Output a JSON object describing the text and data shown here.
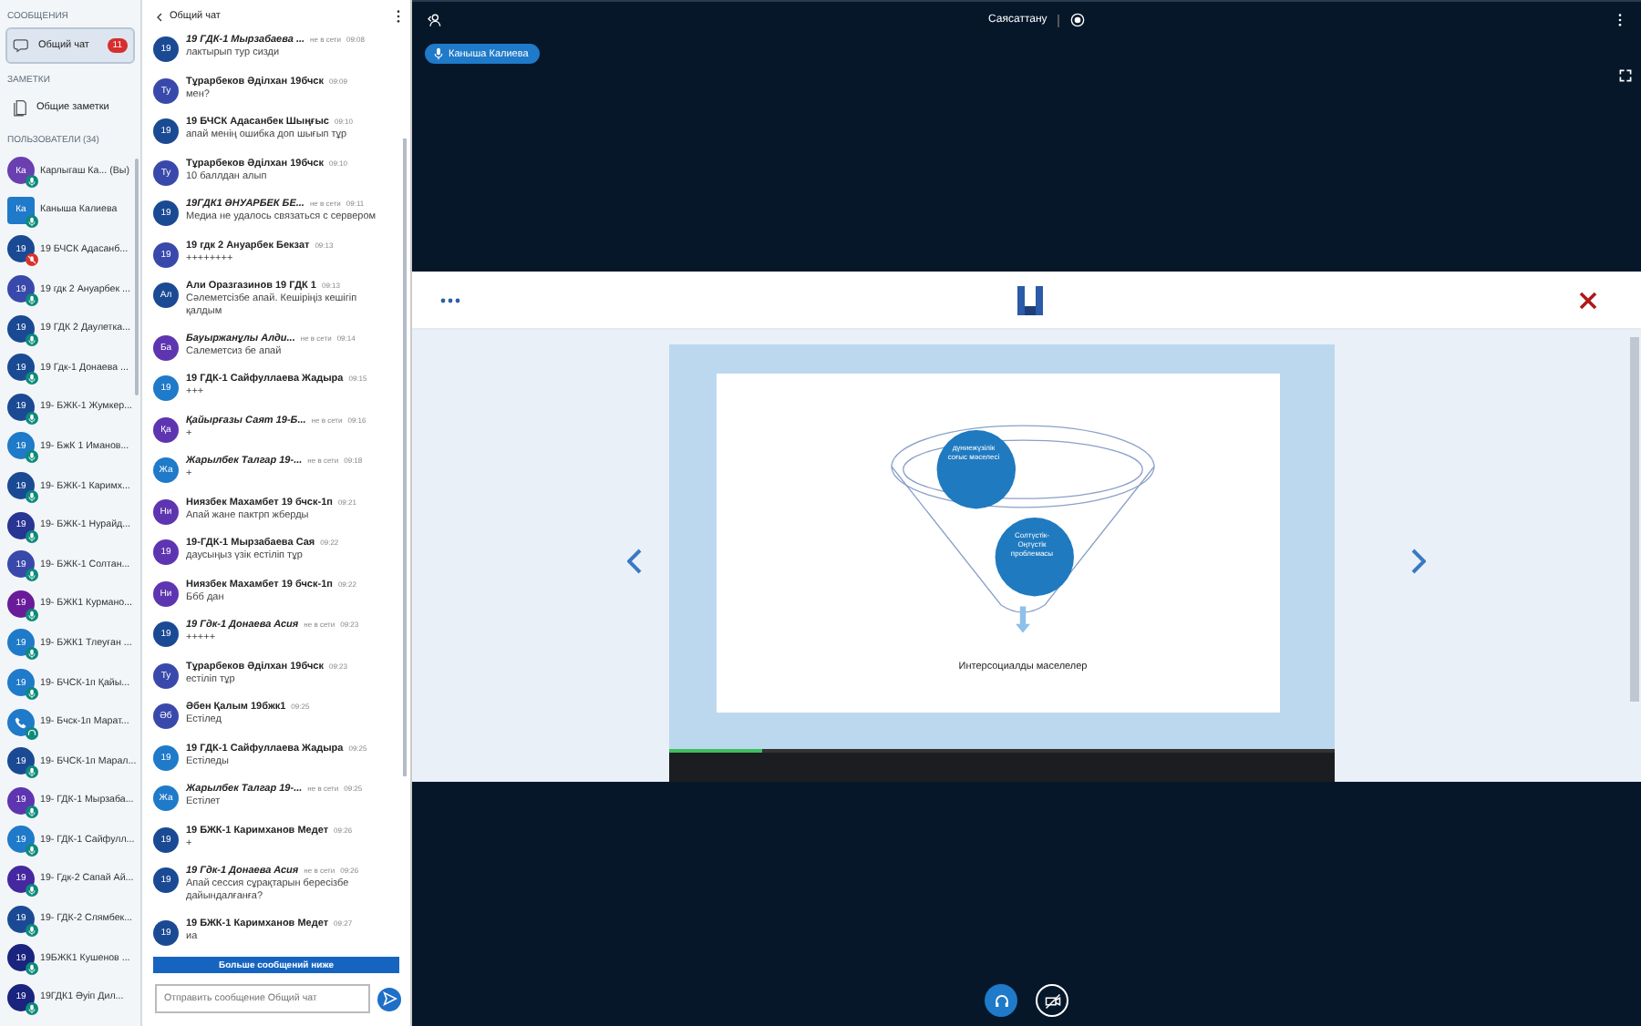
{
  "sidebar": {
    "messages_heading": "СООБЩЕНИЯ",
    "chats": [
      {
        "label": "Общий чат",
        "badge": "11",
        "selected": true
      }
    ],
    "notes_heading": "ЗАМЕТКИ",
    "notes": [
      {
        "label": "Общие заметки",
        "selected": false
      }
    ],
    "users_heading": "ПОЛЬЗОВАТЕЛИ (34)",
    "users": [
      {
        "initials": "Ка",
        "name": "Карлыгаш Ка... (Вы)",
        "color": "#6a3fb0",
        "presenter": false,
        "kind": "mic"
      },
      {
        "initials": "Ка",
        "name": "Каныша Калиева",
        "color": "#1f7ac9",
        "presenter": true,
        "kind": "mic"
      },
      {
        "initials": "19",
        "name": "19 БЧСК Адасанб...",
        "color": "#1b4a94",
        "presenter": false,
        "kind": "muted"
      },
      {
        "initials": "19",
        "name": "19 гдк 2 Ануарбек ...",
        "color": "#3949ab",
        "presenter": false,
        "kind": "mic"
      },
      {
        "initials": "19",
        "name": "19 ГДК 2 Даулетка...",
        "color": "#1b4a94",
        "presenter": false,
        "kind": "mic"
      },
      {
        "initials": "19",
        "name": "19 Гдк-1 Донаева ...",
        "color": "#1b4a94",
        "presenter": false,
        "kind": "mic"
      },
      {
        "initials": "19",
        "name": "19- БЖК-1 Жумкер...",
        "color": "#1b4a94",
        "presenter": false,
        "kind": "mic"
      },
      {
        "initials": "19",
        "name": "19- БжК 1 Иманов...",
        "color": "#1f7ac9",
        "presenter": false,
        "kind": "mic"
      },
      {
        "initials": "19",
        "name": "19- БЖК-1 Каримх...",
        "color": "#1b4a94",
        "presenter": false,
        "kind": "mic"
      },
      {
        "initials": "19",
        "name": "19- БЖК-1 Нурайд...",
        "color": "#283593",
        "presenter": false,
        "kind": "mic"
      },
      {
        "initials": "19",
        "name": "19- БЖК-1 Солтан...",
        "color": "#3949ab",
        "presenter": false,
        "kind": "mic"
      },
      {
        "initials": "19",
        "name": "19- БЖК1 Курмано...",
        "color": "#6a1b9a",
        "presenter": false,
        "kind": "mic"
      },
      {
        "initials": "19",
        "name": "19- БЖК1 Тлеуған ...",
        "color": "#1f7ac9",
        "presenter": false,
        "kind": "mic"
      },
      {
        "initials": "19",
        "name": "19- БЧСК-1п Қайы...",
        "color": "#1f7ac9",
        "presenter": false,
        "kind": "mic"
      },
      {
        "name": "19- Бчск-1п Марат...",
        "color": "#1f7ac9",
        "presenter": false,
        "kind": "phone"
      },
      {
        "initials": "19",
        "name": "19- БЧСК-1п Марал...",
        "color": "#1b4a94",
        "presenter": false,
        "kind": "mic"
      },
      {
        "initials": "19",
        "name": "19- ГДК-1 Мырзаба...",
        "color": "#5e35b1",
        "presenter": false,
        "kind": "mic"
      },
      {
        "initials": "19",
        "name": "19- ГДК-1 Сайфулл...",
        "color": "#1f7ac9",
        "presenter": false,
        "kind": "mic"
      },
      {
        "initials": "19",
        "name": "19- Гдк-2 Сапай Ай...",
        "color": "#4527a0",
        "presenter": false,
        "kind": "mic"
      },
      {
        "initials": "19",
        "name": "19- ГДК-2 Слямбек...",
        "color": "#1b4a94",
        "presenter": false,
        "kind": "mic"
      },
      {
        "initials": "19",
        "name": "19БЖК1 Кушенов ...",
        "color": "#1a237e",
        "presenter": false,
        "kind": "mic"
      },
      {
        "initials": "19",
        "name": "19ГДК1 Әуіп Дил...",
        "color": "#1a237e",
        "presenter": false,
        "kind": "mic"
      }
    ]
  },
  "chat": {
    "title": "Общий чат",
    "messages": [
      {
        "initials": "19",
        "color": "#1b4a94",
        "name": "19 ГДК-1 Мырзабаева ...",
        "offline": true,
        "status": "не в сети",
        "time": "09:08",
        "text": "лактырып тур сизди"
      },
      {
        "initials": "Ту",
        "color": "#3949ab",
        "name": "Тұрарбеков Әділхан 19бчск",
        "offline": false,
        "time": "09:09",
        "text": "мен?"
      },
      {
        "initials": "19",
        "color": "#1b4a94",
        "name": "19 БЧСК Адасанбек Шыңғыс",
        "offline": false,
        "time": "09:10",
        "text": "апай менің ошибка доп шығып тұр"
      },
      {
        "initials": "Ту",
        "color": "#3949ab",
        "name": "Тұрарбеков Әділхан 19бчск",
        "offline": false,
        "time": "09:10",
        "text": "10 баллдан алып"
      },
      {
        "initials": "19",
        "color": "#1b4a94",
        "name": "19ГДК1 ӘНУАРБЕК БЕ...",
        "offline": true,
        "status": "не в сети",
        "time": "09:11",
        "text": "Медиа не удалось связаться с сервером"
      },
      {
        "initials": "19",
        "color": "#3949ab",
        "name": "19 гдк 2 Ануарбек Бекзат",
        "offline": false,
        "time": "09:13",
        "text": "++++++++"
      },
      {
        "initials": "Ал",
        "color": "#1b4a94",
        "name": "Али Оразгазинов 19 ГДК 1",
        "offline": false,
        "time": "09:13",
        "text": "Сәлеметсізбе апай. Кешіріңіз кешігіп қалдым"
      },
      {
        "initials": "Ба",
        "color": "#5e35b1",
        "name": "Бауыржанұлы Алди...",
        "offline": true,
        "status": "не в сети",
        "time": "09:14",
        "text": "Салеметсиз бе апай"
      },
      {
        "initials": "19",
        "color": "#1f7ac9",
        "name": "19 ГДК-1 Сайфуллаева Жадыра",
        "offline": false,
        "time": "09:15",
        "text": "+++"
      },
      {
        "initials": "Қа",
        "color": "#5e35b1",
        "name": "Қайырғазы Саят 19-Б...",
        "offline": true,
        "status": "не в сети",
        "time": "09:16",
        "text": "+"
      },
      {
        "initials": "Жа",
        "color": "#1f7ac9",
        "name": "Жарылбек Талгар 19-...",
        "offline": true,
        "status": "не в сети",
        "time": "09:18",
        "text": "+"
      },
      {
        "initials": "Ни",
        "color": "#5e35b1",
        "name": "Ниязбек Махамбет 19 бчск-1п",
        "offline": false,
        "time": "09:21",
        "text": "Апай жане пактрп жберды"
      },
      {
        "initials": "19",
        "color": "#5e35b1",
        "name": "19-ГДК-1 Мырзабаева Сая",
        "offline": false,
        "time": "09:22",
        "text": "даусыңыз үзік естіліп тұр"
      },
      {
        "initials": "Ни",
        "color": "#5e35b1",
        "name": "Ниязбек Махамбет 19 бчск-1п",
        "offline": false,
        "time": "09:22",
        "text": "Ббб дан"
      },
      {
        "initials": "19",
        "color": "#1b4a94",
        "name": "19 Гдк-1 Донаева Асия",
        "offline": true,
        "status": "не в сети",
        "time": "09:23",
        "text": "+++++"
      },
      {
        "initials": "Ту",
        "color": "#3949ab",
        "name": "Тұрарбеков Әділхан 19бчск",
        "offline": false,
        "time": "09:23",
        "text": "естіліп тұр"
      },
      {
        "initials": "Әб",
        "color": "#3949ab",
        "name": "Әбен Қалым 19бжк1",
        "offline": false,
        "time": "09:25",
        "text": "Естілед"
      },
      {
        "initials": "19",
        "color": "#1f7ac9",
        "name": "19 ГДК-1 Сайфуллаева Жадыра",
        "offline": false,
        "time": "09:25",
        "text": "Естіледы"
      },
      {
        "initials": "Жа",
        "color": "#1f7ac9",
        "name": "Жарылбек Талгар 19-...",
        "offline": true,
        "status": "не в сети",
        "time": "09:25",
        "text": "Естілет"
      },
      {
        "initials": "19",
        "color": "#1b4a94",
        "name": "19 БЖК-1 Каримханов Медет",
        "offline": false,
        "time": "09:26",
        "text": "+"
      },
      {
        "initials": "19",
        "color": "#1b4a94",
        "name": "19 Гдк-1 Донаева Асия",
        "offline": true,
        "status": "не в сети",
        "time": "09:26",
        "text": "Апай сессия сұрақтарын бересізбе дайындалғанға?"
      },
      {
        "initials": "19",
        "color": "#1b4a94",
        "name": "19 БЖК-1 Каримханов Медет",
        "offline": false,
        "time": "09:27",
        "text": "иа"
      }
    ],
    "more_banner": "Больше сообщений ниже",
    "input": {
      "placeholder": "Отправить сообщение Общий чат"
    }
  },
  "topbar": {
    "title": "Саясаттану",
    "recording": true
  },
  "talker": {
    "name": "Каныша Калиева"
  },
  "slide": {
    "circles": [
      {
        "text": "дүниежүзілік соғыс мәселесі"
      },
      {
        "text": "Солтүстік-Оңтүстік проблемасы"
      }
    ],
    "caption": "Интерсоциалды маселелер"
  }
}
